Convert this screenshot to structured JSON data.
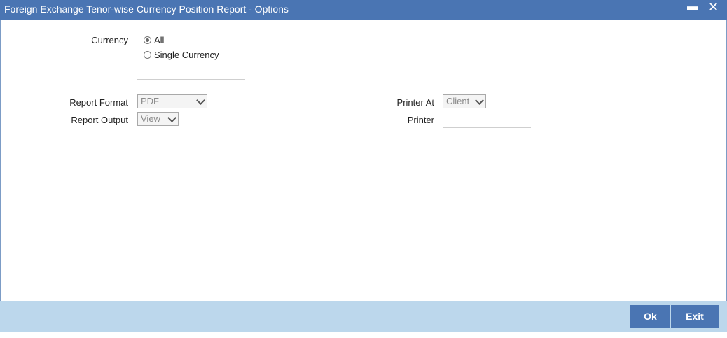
{
  "window": {
    "title": "Foreign Exchange Tenor-wise Currency Position Report - Options",
    "minimize_glyph": "▬",
    "close_glyph": "✕"
  },
  "form": {
    "currency_label": "Currency",
    "currency_options": [
      {
        "label": "All",
        "selected": true
      },
      {
        "label": "Single Currency",
        "selected": false
      }
    ],
    "report_format_label": "Report Format",
    "report_format_value": "PDF",
    "report_output_label": "Report Output",
    "report_output_value": "View",
    "printer_at_label": "Printer At",
    "printer_at_value": "Client",
    "printer_label": "Printer",
    "printer_value": ""
  },
  "footer": {
    "ok_label": "Ok",
    "exit_label": "Exit"
  },
  "colors": {
    "titlebar": "#4a75b3",
    "footer": "#bcd7ec",
    "button": "#4a75b3"
  }
}
